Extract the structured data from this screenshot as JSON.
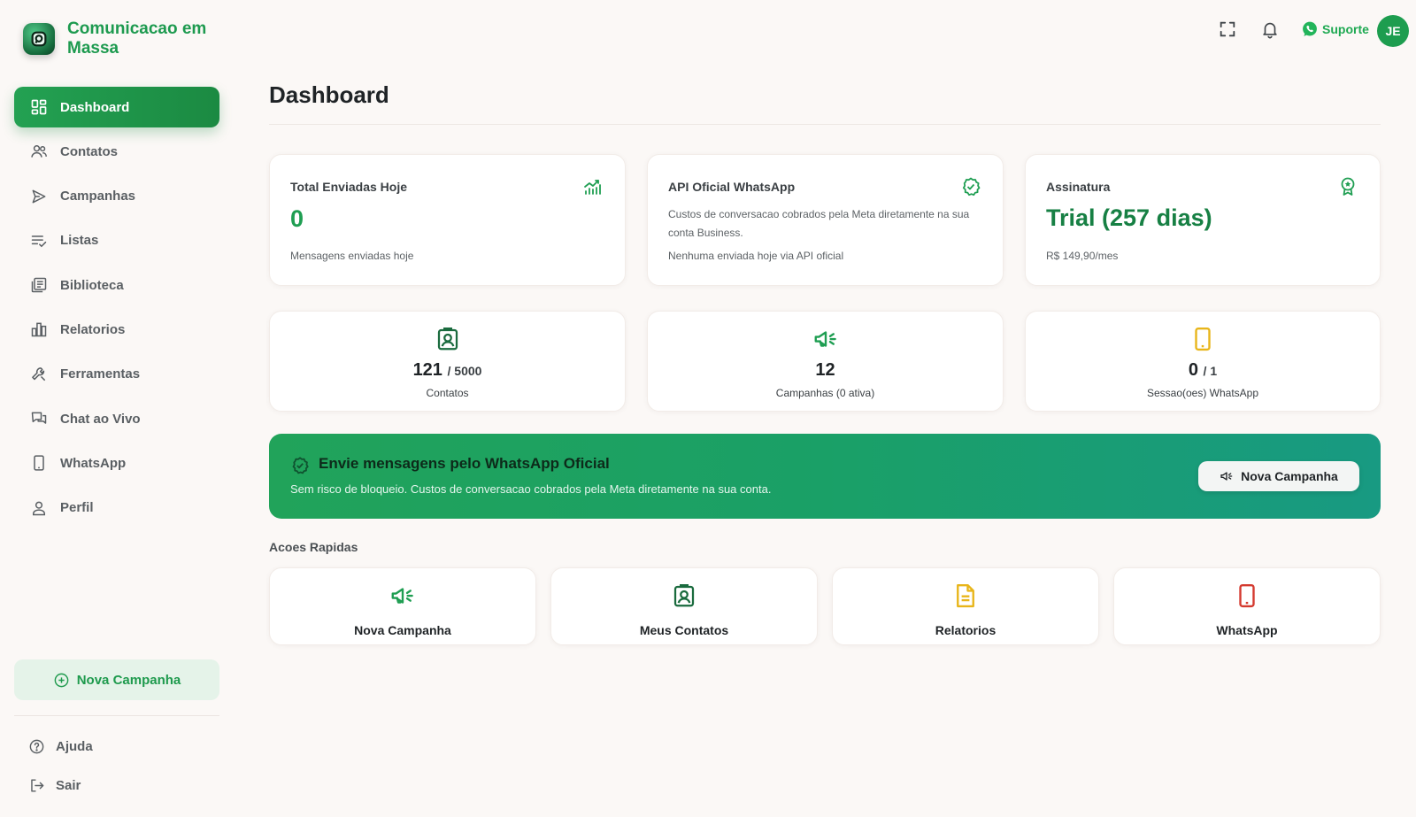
{
  "brand": {
    "name": "Comunicacao em Massa"
  },
  "sidebar": {
    "items": [
      {
        "label": "Dashboard",
        "icon": "dashboard-icon",
        "active": true
      },
      {
        "label": "Contatos",
        "icon": "users-icon"
      },
      {
        "label": "Campanhas",
        "icon": "send-icon"
      },
      {
        "label": "Listas",
        "icon": "list-check-icon"
      },
      {
        "label": "Biblioteca",
        "icon": "library-icon"
      },
      {
        "label": "Relatorios",
        "icon": "bar-chart-icon"
      },
      {
        "label": "Ferramentas",
        "icon": "wrench-icon"
      },
      {
        "label": "Chat ao Vivo",
        "icon": "chat-icon"
      },
      {
        "label": "WhatsApp",
        "icon": "phone-icon"
      },
      {
        "label": "Perfil",
        "icon": "user-icon"
      }
    ],
    "new_campaign_label": "Nova Campanha",
    "help_label": "Ajuda",
    "logout_label": "Sair"
  },
  "topbar": {
    "support_label": "Suporte",
    "avatar_initials": "JE"
  },
  "page": {
    "title": "Dashboard"
  },
  "cards": {
    "sent_today": {
      "label": "Total Enviadas Hoje",
      "value": "0",
      "subtitle": "Mensagens enviadas hoje"
    },
    "api": {
      "label": "API Oficial WhatsApp",
      "description": "Custos de conversacao cobrados pela Meta diretamente na sua conta Business.",
      "subtitle": "Nenhuma enviada hoje via API oficial"
    },
    "subscription": {
      "label": "Assinatura",
      "value": "Trial (257 dias)",
      "price": "R$ 149,90/mes"
    }
  },
  "stats": {
    "contacts": {
      "value": "121",
      "of": "/ 5000",
      "label": "Contatos"
    },
    "campaigns": {
      "value": "12",
      "label": "Campanhas (0 ativa)"
    },
    "sessions": {
      "value": "0",
      "of": "/ 1",
      "label": "Sessao(oes) WhatsApp"
    }
  },
  "banner": {
    "title": "Envie mensagens pelo WhatsApp Oficial",
    "subtitle": "Sem risco de bloqueio. Custos de conversacao cobrados pela Meta diretamente na sua conta.",
    "button_label": "Nova Campanha"
  },
  "quick_actions": {
    "title": "Acoes Rapidas",
    "items": [
      {
        "label": "Nova Campanha",
        "color": "#1f9e52"
      },
      {
        "label": "Meus Contatos",
        "color": "#1a6b3e"
      },
      {
        "label": "Relatorios",
        "color": "#e8b51a"
      },
      {
        "label": "WhatsApp",
        "color": "#d43a2f"
      }
    ]
  },
  "colors": {
    "brand_green": "#1d9a4f",
    "accent_teal": "#189a82",
    "background": "#fbf8f6"
  }
}
